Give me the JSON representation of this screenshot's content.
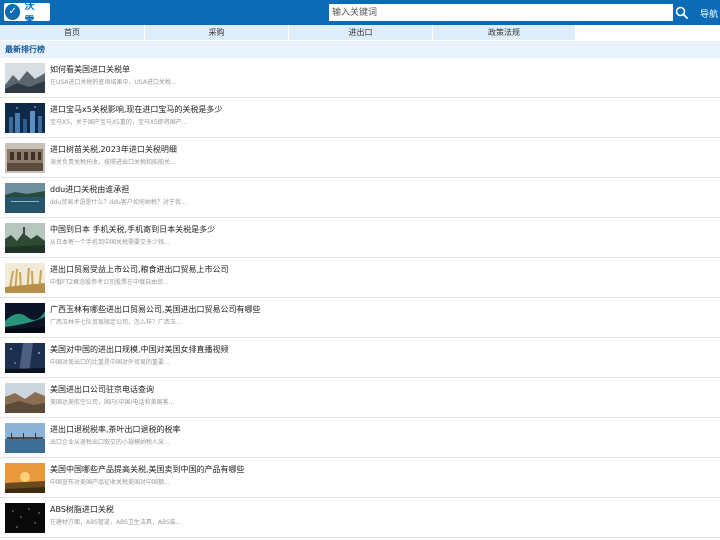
{
  "header": {
    "logo_text": "沃 零",
    "search_placeholder": "输入关键词",
    "nav_label": "导航"
  },
  "tabs": [
    {
      "label": "首页"
    },
    {
      "label": "采购"
    },
    {
      "label": "进出口"
    },
    {
      "label": "政策法规"
    }
  ],
  "section": {
    "title": "最新排行榜"
  },
  "articles": [
    {
      "title": "如何看美国进口关税单",
      "desc": "在USA进口关税的查询结果中，USA进口关税...",
      "thumb": "mountain-fog"
    },
    {
      "title": "进口宝马x5关税影响,现在进口宝马的关税是多少",
      "desc": "宝马X5，关于国产宝马X5重的，宝马X5即将国产...",
      "thumb": "city-night"
    },
    {
      "title": "进口树苗关税,2023年进口关税明细",
      "desc": "海关负责关税托收，按照进出口关税和船舶关...",
      "thumb": "old-building"
    },
    {
      "title": "ddu进口关税由谁承担",
      "desc": "ddu贸易术语是什么？ddu客户如何纳税？对于我...",
      "thumb": "night-lake"
    },
    {
      "title": "中国到日本 手机关税,手机寄到日本关税是多少",
      "desc": "从日本寄一个手机到中国关税需要交多少钱...",
      "thumb": "forest-tower"
    },
    {
      "title": "进出口贸易受益上市公司,粮食进出口贸易上市公司",
      "desc": "中俄FTZ概念股参考公司股票在中俄自由贸...",
      "thumb": "wheat-field"
    },
    {
      "title": "广西玉林有哪些进出口贸易公司,美国进出口贸易公司有哪些",
      "desc": "广西玉林市七队贸易限定公司，怎么样？广西玉...",
      "thumb": "aurora"
    },
    {
      "title": "美国对中国的进出口规模,中国对美国女排直播视频",
      "desc": "中国对美出口的比重是中国对外贸易的重要...",
      "thumb": "starry-sky"
    },
    {
      "title": "美国进出口公司驻京电话查询",
      "desc": "美国达美航空公司，国内(中国)电话和美国客...",
      "thumb": "canyon"
    },
    {
      "title": "进出口退税税率,茶叶出口退税的税率",
      "desc": "出口企业从退税出口取交的小规模纳税人采...",
      "thumb": "dock-sky"
    },
    {
      "title": "美国中国哪些产品提高关税,美国卖到中国的产品有哪些",
      "desc": "中国宣布对美国产品征收关税美国对中国额...",
      "thumb": "sunset-field"
    },
    {
      "title": "ABS树脂进口关税",
      "desc": "在建材方面，ABS管道，ABS卫生洁具，ABS装...",
      "thumb": "dark-particles"
    }
  ],
  "colors": {
    "brand": "#0b6cb5",
    "tab_bg": "#ddeefa",
    "section_bg": "#e9f2fb",
    "section_text": "#125a97"
  }
}
